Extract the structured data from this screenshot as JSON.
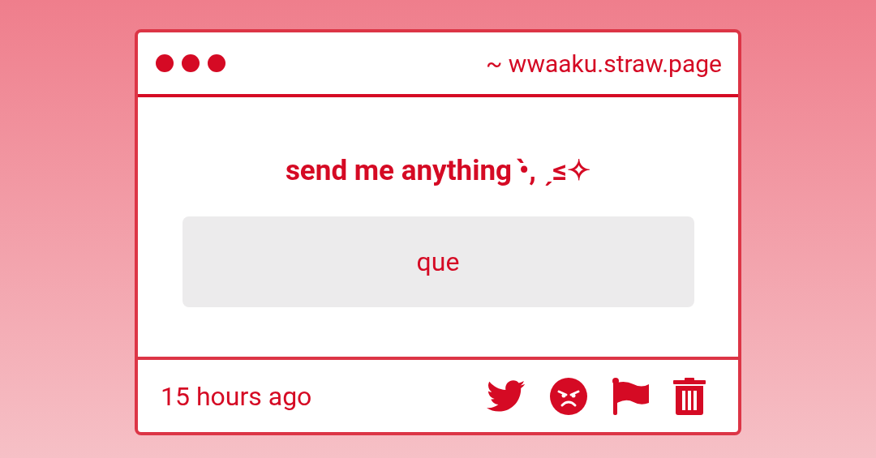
{
  "window": {
    "url": "~ wwaaku.straw.page"
  },
  "prompt": {
    "title": "send me anything •̀, ˏ≤✧"
  },
  "message": {
    "text": "que"
  },
  "footer": {
    "time": "15 hours ago"
  }
}
